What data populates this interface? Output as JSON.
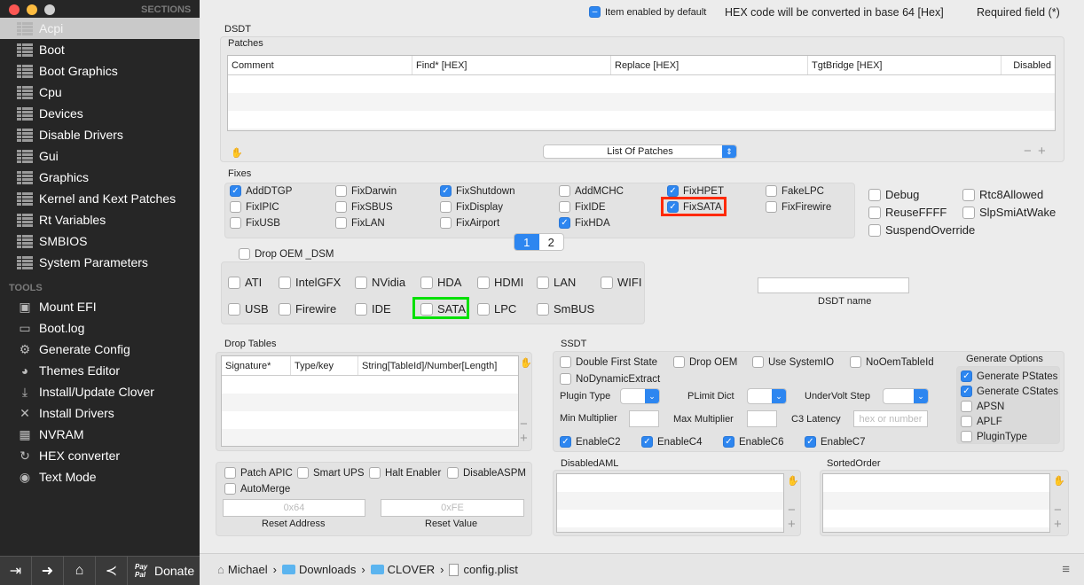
{
  "sidebar": {
    "sections_header": "SECTIONS",
    "sections": [
      "Acpi",
      "Boot",
      "Boot Graphics",
      "Cpu",
      "Devices",
      "Disable Drivers",
      "Gui",
      "Graphics",
      "Kernel and Kext Patches",
      "Rt Variables",
      "SMBIOS",
      "System Parameters"
    ],
    "selected": "Acpi",
    "tools_header": "TOOLS",
    "tools": [
      {
        "label": "Mount EFI",
        "icon": "disk-icon"
      },
      {
        "label": "Boot.log",
        "icon": "laptop-icon"
      },
      {
        "label": "Generate Config",
        "icon": "gears-icon"
      },
      {
        "label": "Themes Editor",
        "icon": "palette-icon"
      },
      {
        "label": "Install/Update Clover",
        "icon": "download-icon"
      },
      {
        "label": "Install Drivers",
        "icon": "tools-icon"
      },
      {
        "label": "NVRAM",
        "icon": "chip-icon"
      },
      {
        "label": "HEX converter",
        "icon": "refresh-icon"
      },
      {
        "label": "Text Mode",
        "icon": "eye-icon"
      }
    ],
    "bottom": {
      "paypal": "Pay Pal",
      "donate": "Donate"
    }
  },
  "header": {
    "item_enabled": "Item enabled by default",
    "hex_note": "HEX code will be converted in base 64 [Hex]",
    "required": "Required field (*)"
  },
  "dsdt": {
    "title": "DSDT",
    "patches_title": "Patches",
    "patch_columns": [
      "Comment",
      "Find* [HEX]",
      "Replace [HEX]",
      "TgtBridge [HEX]",
      "Disabled"
    ],
    "patch_list_popup": "List Of Patches",
    "fixes_title": "Fixes",
    "fixes": [
      {
        "label": "AddDTGP",
        "checked": true
      },
      {
        "label": "FixDarwin",
        "checked": false
      },
      {
        "label": "FixShutdown",
        "checked": true
      },
      {
        "label": "AddMCHC",
        "checked": false
      },
      {
        "label": "FixHPET",
        "checked": true
      },
      {
        "label": "FakeLPC",
        "checked": false
      },
      {
        "label": "FixIPIC",
        "checked": false
      },
      {
        "label": "FixSBUS",
        "checked": false
      },
      {
        "label": "FixDisplay",
        "checked": false
      },
      {
        "label": "FixIDE",
        "checked": false
      },
      {
        "label": "FixSATA",
        "checked": true
      },
      {
        "label": "FixFirewire",
        "checked": false
      },
      {
        "label": "FixUSB",
        "checked": false
      },
      {
        "label": "FixLAN",
        "checked": false
      },
      {
        "label": "FixAirport",
        "checked": false
      },
      {
        "label": "FixHDA",
        "checked": true
      }
    ],
    "pages": [
      "1",
      "2"
    ],
    "active_page": "1",
    "options": [
      {
        "label": "Debug",
        "checked": false
      },
      {
        "label": "Rtc8Allowed",
        "checked": false
      },
      {
        "label": "ReuseFFFF",
        "checked": false
      },
      {
        "label": "SlpSmiAtWake",
        "checked": false
      },
      {
        "label": "SuspendOverride",
        "checked": false
      }
    ],
    "drop_oem_dsm": {
      "label": "Drop OEM _DSM",
      "checked": false
    },
    "dsm": [
      {
        "label": "ATI"
      },
      {
        "label": "IntelGFX"
      },
      {
        "label": "NVidia"
      },
      {
        "label": "HDA"
      },
      {
        "label": "HDMI"
      },
      {
        "label": "LAN"
      },
      {
        "label": "WIFI"
      },
      {
        "label": "USB"
      },
      {
        "label": "Firewire"
      },
      {
        "label": "IDE"
      },
      {
        "label": "SATA"
      },
      {
        "label": "LPC"
      },
      {
        "label": "SmBUS"
      }
    ],
    "dsdt_name_label": "DSDT name",
    "dsdt_name_value": "",
    "highlight_colors": {
      "fixsata": "#ff2a00",
      "sata": "#00e000"
    }
  },
  "drop_tables": {
    "title": "Drop Tables",
    "columns": [
      "Signature*",
      "Type/key",
      "String[TableId]/Number[Length]"
    ]
  },
  "misc": {
    "checks": [
      {
        "label": "Patch APIC",
        "checked": false
      },
      {
        "label": "Smart UPS",
        "checked": false
      },
      {
        "label": "Halt Enabler",
        "checked": false
      },
      {
        "label": "DisableASPM",
        "checked": false
      },
      {
        "label": "AutoMerge",
        "checked": false
      }
    ],
    "reset_address_placeholder": "0x64",
    "reset_value_placeholder": "0xFE",
    "reset_address_label": "Reset Address",
    "reset_value_label": "Reset Value"
  },
  "ssdt": {
    "title": "SSDT",
    "checks": [
      {
        "label": "Double First State",
        "checked": false
      },
      {
        "label": "Drop OEM",
        "checked": false
      },
      {
        "label": "Use SystemIO",
        "checked": false
      },
      {
        "label": "NoOemTableId",
        "checked": false
      },
      {
        "label": "NoDynamicExtract",
        "checked": false
      }
    ],
    "plugin_type": "Plugin Type",
    "plimit_dict": "PLimit Dict",
    "undervolt_step": "UnderVolt Step",
    "min_multiplier": "Min Multiplier",
    "max_multiplier": "Max Multiplier",
    "c3_latency": "C3 Latency",
    "c3_placeholder": "hex or number",
    "enable": [
      {
        "label": "EnableC2",
        "checked": true
      },
      {
        "label": "EnableC4",
        "checked": true
      },
      {
        "label": "EnableC6",
        "checked": true
      },
      {
        "label": "EnableC7",
        "checked": true
      }
    ],
    "generate_title": "Generate Options",
    "generate": [
      {
        "label": "Generate PStates",
        "checked": true
      },
      {
        "label": "Generate CStates",
        "checked": true
      },
      {
        "label": "APSN",
        "checked": false
      },
      {
        "label": "APLF",
        "checked": false
      },
      {
        "label": "PluginType",
        "checked": false
      }
    ]
  },
  "disabled_aml": {
    "title": "DisabledAML"
  },
  "sorted_order": {
    "title": "SortedOrder"
  },
  "path": [
    "Michael",
    "Downloads",
    "CLOVER",
    "config.plist"
  ],
  "accent": "#2d86f0"
}
